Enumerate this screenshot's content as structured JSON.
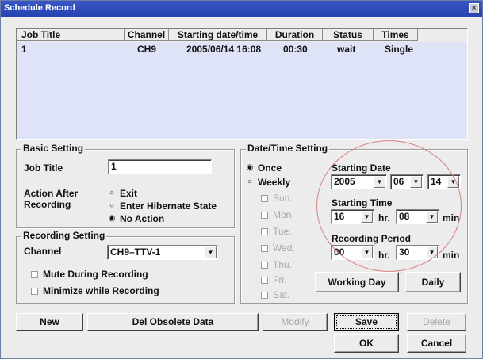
{
  "window": {
    "title": "Schedule Record",
    "close_glyph": "×"
  },
  "list": {
    "columns": [
      "Job Title",
      "Channel",
      "Starting date/time",
      "Duration",
      "Status",
      "Times"
    ],
    "rows": [
      {
        "job_title": "1",
        "channel": "CH9",
        "start": "2005/06/14 16:08",
        "duration": "00:30",
        "status": "wait",
        "times": "Single"
      }
    ]
  },
  "basic": {
    "label": "Basic Setting",
    "job_title_label": "Job Title",
    "job_title_value": "1",
    "action_label_1": "Action After",
    "action_label_2": "Recording",
    "actions": [
      "Exit",
      "Enter Hibernate State",
      "No Action"
    ],
    "selected_action": "No Action"
  },
  "recording": {
    "label": "Recording Setting",
    "channel_label": "Channel",
    "channel_value": "CH9–TTV-1",
    "mute_label": "Mute During Recording",
    "minimize_label": "Minimize while Recording"
  },
  "datetime": {
    "label": "Date/Time Setting",
    "once_label": "Once",
    "weekly_label": "Weekly",
    "days": [
      "Sun.",
      "Mon.",
      "Tue.",
      "Wed.",
      "Thu.",
      "Fri.",
      "Sat."
    ],
    "starting_date_label": "Starting Date",
    "year": "2005",
    "month": "06",
    "day": "14",
    "starting_time_label": "Starting Time",
    "hour": "16",
    "hr_label": "hr.",
    "minute": "08",
    "min_label": "min",
    "period_label": "Recording Period",
    "period_hour": "00",
    "period_minute": "30",
    "working_day_label": "Working Day",
    "daily_label": "Daily"
  },
  "buttons": {
    "new": "New",
    "del_obsolete": "Del Obsolete Data",
    "modify": "Modify",
    "save": "Save",
    "delete": "Delete",
    "ok": "OK",
    "cancel": "Cancel"
  },
  "icons": {
    "dropdown": "▼",
    "radio_on": "◉",
    "radio_off": "○"
  }
}
